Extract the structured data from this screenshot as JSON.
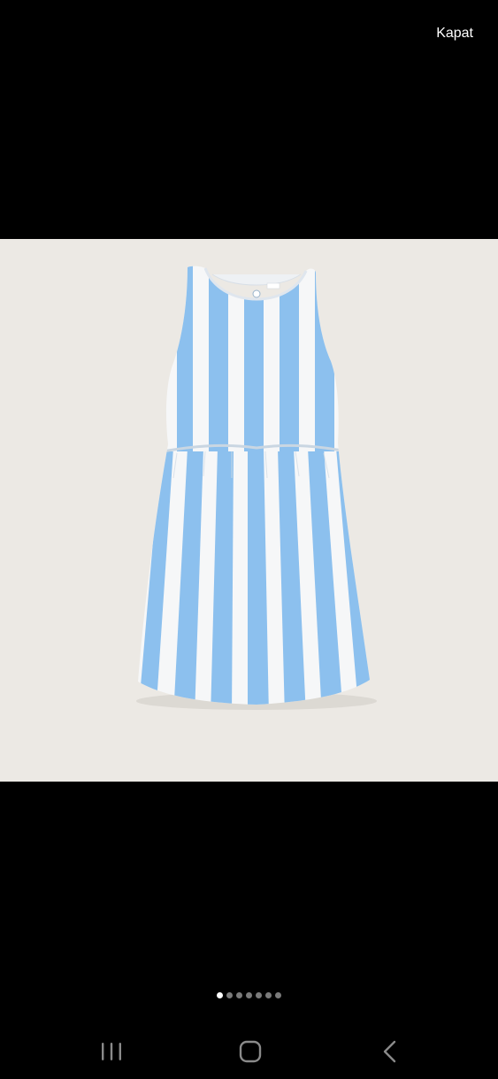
{
  "header": {
    "close_label": "Kapat"
  },
  "colors": {
    "background": "#000000",
    "photo_background": "#ece9e4",
    "stripe_blue": "#8cc0ee",
    "stripe_white": "#f6f7f8",
    "active_dot": "#ffffff",
    "inactive_dot": "#7a7a7a"
  },
  "gallery": {
    "page_count": 7,
    "current_page": 1
  },
  "nav": {
    "recent_icon": "recent-apps-icon",
    "home_icon": "home-icon",
    "back_icon": "back-icon"
  }
}
